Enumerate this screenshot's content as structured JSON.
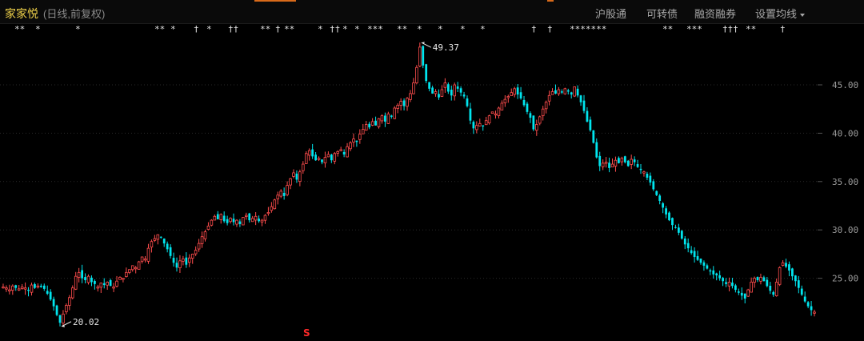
{
  "header": {
    "stock_name": "家家悦",
    "period_label": "(日线,前复权)",
    "menu": [
      {
        "label": "沪股通",
        "has_caret": false
      },
      {
        "label": "可转债",
        "has_caret": false
      },
      {
        "label": "融资融券",
        "has_caret": false
      },
      {
        "label": "设置均线",
        "has_caret": true
      }
    ]
  },
  "markers": [
    "**",
    "*",
    "*",
    "**",
    "*",
    "†",
    "*",
    "††",
    "**",
    "†",
    "**",
    "*",
    "††",
    "*",
    "*",
    "***",
    "**",
    "*",
    "*",
    "*",
    "*",
    "†",
    "†",
    "*******",
    "**",
    "***",
    "†††",
    "**",
    "†"
  ],
  "colors": {
    "up": "#ff4d4d",
    "down": "#00e5ee",
    "background": "#000000",
    "grid": "#2a2a2a",
    "stock_name": "#f0d24a"
  },
  "special_mark": "S",
  "chart_data": {
    "type": "candlestick",
    "title": "家家悦",
    "subtitle": "(日线,前复权)",
    "ylim": [
      20,
      50
    ],
    "yticks": [
      25,
      30,
      35,
      40,
      45
    ],
    "ytick_labels": [
      "25.00",
      "30.00",
      "35.00",
      "40.00",
      "45.00"
    ],
    "grid": "horizontal-dotted",
    "legend": "none",
    "annotations": [
      {
        "label": "49.37",
        "value": 49.37,
        "kind": "high"
      },
      {
        "label": "20.02",
        "value": 20.02,
        "kind": "low"
      }
    ],
    "series": [
      {
        "name": "",
        "close_path": [
          24.1,
          24.0,
          23.8,
          24.2,
          24.0,
          23.9,
          24.1,
          24.0,
          23.7,
          24.3,
          24.0,
          24.2,
          24.1,
          23.9,
          23.4,
          22.8,
          22.1,
          21.2,
          20.4,
          21.3,
          22.2,
          23.0,
          24.0,
          25.2,
          25.6,
          25.0,
          24.8,
          25.2,
          24.6,
          24.4,
          24.1,
          24.5,
          24.3,
          24.6,
          24.2,
          24.1,
          24.7,
          25.1,
          25.0,
          25.6,
          25.9,
          26.3,
          26.1,
          26.7,
          27.2,
          27.0,
          28.1,
          28.8,
          29.1,
          29.5,
          29.2,
          28.6,
          28.0,
          27.3,
          26.6,
          26.1,
          26.8,
          27.0,
          26.4,
          27.1,
          27.5,
          27.9,
          28.6,
          29.3,
          29.8,
          30.4,
          31.0,
          31.4,
          31.1,
          31.6,
          30.9,
          30.7,
          31.2,
          30.8,
          31.0,
          30.6,
          31.3,
          31.5,
          31.0,
          31.2,
          31.4,
          30.9,
          31.0,
          31.5,
          31.8,
          32.4,
          33.1,
          33.6,
          34.0,
          33.5,
          34.6,
          35.3,
          35.9,
          35.2,
          36.0,
          36.8,
          37.9,
          38.2,
          37.6,
          37.2,
          37.4,
          37.0,
          37.5,
          37.8,
          37.2,
          37.9,
          38.1,
          38.3,
          37.8,
          38.6,
          39.0,
          39.4,
          39.1,
          39.9,
          40.4,
          40.9,
          40.6,
          41.2,
          40.8,
          41.5,
          41.8,
          41.2,
          42.0,
          41.7,
          42.6,
          42.9,
          43.3,
          42.8,
          43.6,
          44.1,
          45.2,
          46.8,
          48.9,
          47.0,
          45.4,
          44.6,
          44.1,
          44.3,
          43.7,
          44.5,
          45.2,
          44.3,
          43.9,
          45.0,
          44.6,
          44.2,
          43.8,
          42.8,
          41.3,
          40.5,
          40.8,
          41.0,
          40.7,
          41.3,
          41.8,
          42.2,
          42.0,
          42.6,
          43.1,
          43.5,
          43.8,
          44.2,
          44.6,
          44.0,
          43.6,
          42.9,
          42.2,
          41.6,
          40.4,
          40.9,
          41.7,
          42.5,
          43.2,
          43.9,
          44.3,
          44.1,
          44.5,
          44.2,
          44.6,
          44.3,
          44.0,
          44.8,
          43.9,
          43.2,
          42.3,
          41.2,
          40.3,
          39.0,
          37.5,
          36.6,
          36.9,
          37.0,
          36.4,
          36.8,
          37.2,
          36.9,
          37.4,
          37.0,
          36.6,
          37.3,
          37.0,
          36.5,
          36.2,
          36.0,
          35.4,
          34.9,
          34.2,
          33.6,
          33.0,
          32.3,
          31.6,
          31.0,
          30.5,
          30.2,
          29.7,
          29.1,
          28.5,
          28.1,
          27.6,
          27.2,
          26.9,
          26.6,
          26.3,
          26.0,
          25.7,
          25.4,
          25.3,
          25.0,
          24.7,
          24.4,
          24.6,
          24.2,
          23.8,
          23.5,
          23.2,
          22.9,
          23.8,
          24.6,
          25.0,
          24.8,
          25.1,
          24.7,
          24.2,
          23.7,
          23.3,
          24.6,
          26.1,
          26.6,
          26.2,
          25.8,
          25.2,
          24.7,
          24.0,
          23.3,
          22.6,
          22.1,
          21.7,
          21.5
        ]
      }
    ]
  }
}
